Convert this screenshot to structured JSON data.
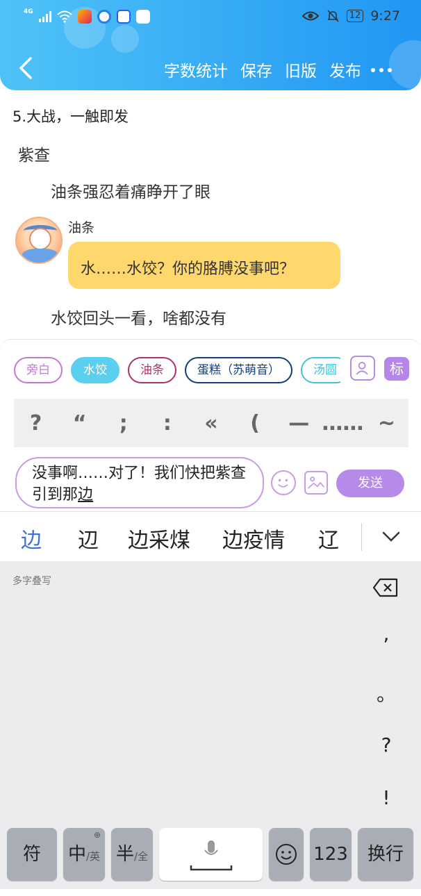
{
  "status_bar": {
    "network": "4G",
    "battery": "12",
    "time": "9:27"
  },
  "toolbar": {
    "back_icon": "chevron-left-icon",
    "actions": [
      "字数统计",
      "保存",
      "旧版",
      "发布"
    ],
    "more_icon": "ellipsis-icon"
  },
  "story": {
    "chapter_title": "5.大战，一触即发",
    "narration_1": "紫查",
    "narration_2": "油条强忍着痛睁开了眼",
    "message": {
      "speaker": "油条",
      "text": "水……水饺？你的胳膊没事吧？"
    },
    "narration_3": "水饺回头一看，啥都没有"
  },
  "characters": [
    "旁白",
    "水饺",
    "油条",
    "蛋糕（苏萌音）",
    "汤圆"
  ],
  "tools": {
    "role_icon": "role-card-icon",
    "tag_label": "标"
  },
  "punctuation": [
    "?",
    "“",
    ";",
    ":",
    "«",
    "(",
    "—",
    "……",
    "~"
  ],
  "composer": {
    "text": "没事啊……对了！我们快把紫查引到那",
    "composing": "边",
    "emoji_icon": "emoji-icon",
    "image_icon": "image-icon",
    "send_label": "发送"
  },
  "ime": {
    "candidates": [
      "边",
      "辺",
      "边采煤",
      "边疫情",
      "辽"
    ],
    "collapse_icon": "chevron-down-icon",
    "hint": "多字叠写",
    "side_punct": [
      ",",
      "。",
      "?",
      "!"
    ],
    "keys": {
      "symbol": "符",
      "lang_main": "中",
      "lang_sub": "/英",
      "width_main": "半",
      "width_sub": "/全",
      "numbers": "123",
      "newline": "换行"
    }
  },
  "colors": {
    "header_start": "#4fc3f7",
    "header_end": "#2196f3",
    "bubble": "#fed86c",
    "accent_purple": "#b58ae8",
    "candidate_active": "#3f6fd8"
  }
}
